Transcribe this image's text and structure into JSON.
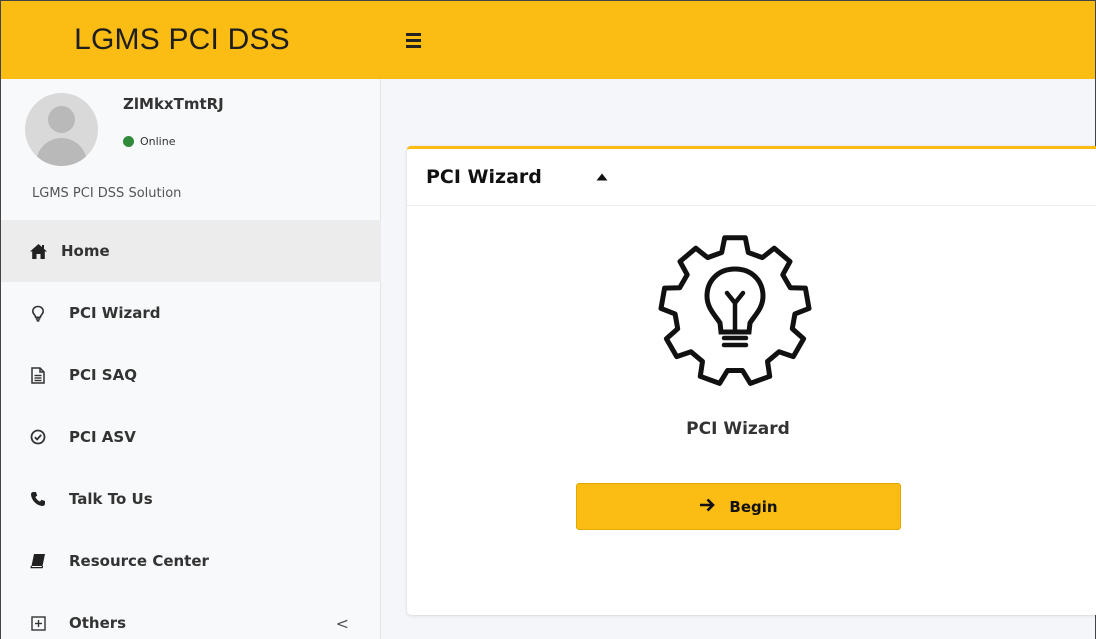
{
  "topbar": {
    "brand": "LGMS PCI DSS",
    "menu_icon": "hamburger-icon",
    "color": "#fbbc14"
  },
  "user": {
    "name": "ZlMkxTmtRJ",
    "status": "Online",
    "status_color": "#2f8a3a"
  },
  "sidebar": {
    "header": "LGMS PCI DSS Solution",
    "items": [
      {
        "label": "Home",
        "icon": "home-icon",
        "active": true
      },
      {
        "label": "PCI Wizard",
        "icon": "lightbulb-icon"
      },
      {
        "label": "PCI SAQ",
        "icon": "document-icon"
      },
      {
        "label": "PCI ASV",
        "icon": "check-circle-icon"
      },
      {
        "label": "Talk To Us",
        "icon": "phone-icon"
      },
      {
        "label": "Resource Center",
        "icon": "book-icon"
      },
      {
        "label": "Others",
        "icon": "plus-square-icon",
        "chevron": "<"
      }
    ]
  },
  "card": {
    "title": "PCI Wizard",
    "collapse_icon": "caret-up-icon",
    "main_icon": "gear-lightbulb-icon",
    "label": "PCI Wizard",
    "button_label": "Begin",
    "button_icon": "arrow-right-icon"
  }
}
